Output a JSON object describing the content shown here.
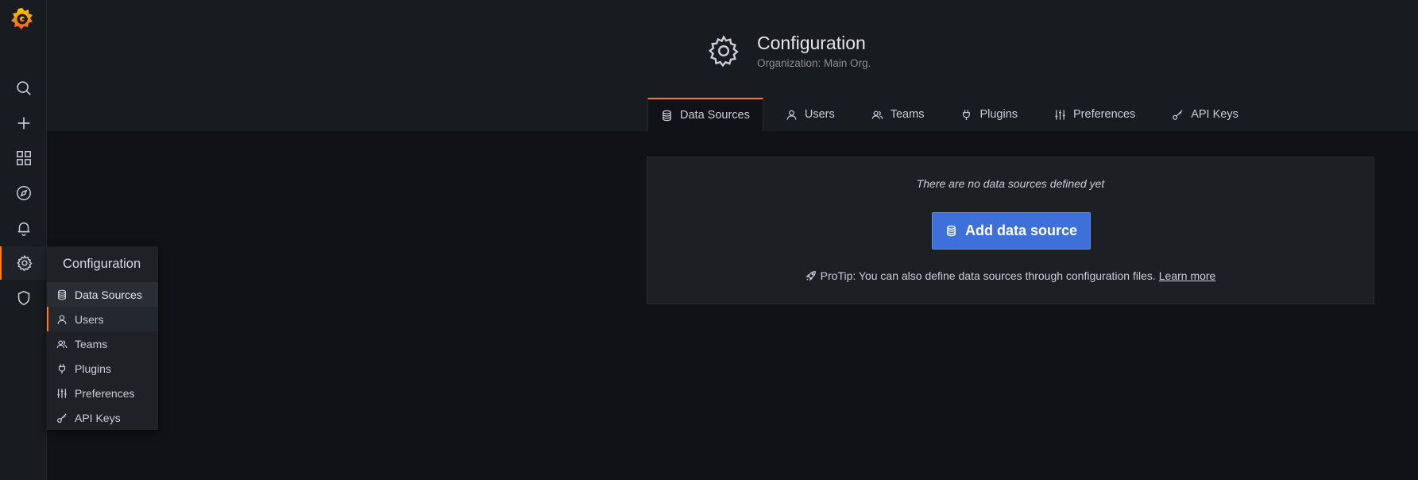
{
  "sidemenu": {
    "items": [
      {
        "icon": "search-icon"
      },
      {
        "icon": "plus-icon"
      },
      {
        "icon": "dashboards-icon"
      },
      {
        "icon": "explore-icon"
      },
      {
        "icon": "bell-icon"
      },
      {
        "icon": "gear-icon",
        "active": true
      },
      {
        "icon": "shield-icon"
      }
    ],
    "flyout": {
      "header": "Configuration",
      "items": [
        {
          "label": "Data Sources",
          "icon": "database-icon"
        },
        {
          "label": "Users",
          "icon": "user-icon"
        },
        {
          "label": "Teams",
          "icon": "users-icon"
        },
        {
          "label": "Plugins",
          "icon": "plug-icon"
        },
        {
          "label": "Preferences",
          "icon": "sliders-icon"
        },
        {
          "label": "API Keys",
          "icon": "key-icon"
        }
      ]
    }
  },
  "header": {
    "title": "Configuration",
    "subtitle": "Organization: Main Org."
  },
  "tabs": [
    {
      "label": "Data Sources",
      "icon": "database-icon",
      "active": true
    },
    {
      "label": "Users",
      "icon": "user-icon"
    },
    {
      "label": "Teams",
      "icon": "users-icon"
    },
    {
      "label": "Plugins",
      "icon": "plug-icon"
    },
    {
      "label": "Preferences",
      "icon": "sliders-icon"
    },
    {
      "label": "API Keys",
      "icon": "key-icon"
    }
  ],
  "empty": {
    "message": "There are no data sources defined yet",
    "button": "Add data source",
    "protip": "ProTip: You can also define data sources through configuration files.",
    "learn_more": "Learn more"
  },
  "colors": {
    "accent": "#ff7a1a",
    "primary": "#3d71d9",
    "background": "#111217",
    "panel": "#181b1f"
  }
}
